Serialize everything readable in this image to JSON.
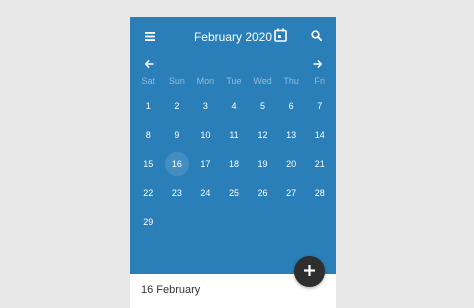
{
  "header": {
    "title": "February 2020",
    "menu_icon": "hamburger-menu-icon",
    "today_icon": "calendar-icon",
    "search_icon": "search-icon"
  },
  "weekdays": [
    "Sat",
    "Sun",
    "Mon",
    "Tue",
    "Wed",
    "Thu",
    "Fri"
  ],
  "days": [
    "1",
    "2",
    "3",
    "4",
    "5",
    "6",
    "7",
    "8",
    "9",
    "10",
    "11",
    "12",
    "13",
    "14",
    "15",
    "16",
    "17",
    "18",
    "19",
    "20",
    "21",
    "22",
    "23",
    "24",
    "25",
    "26",
    "27",
    "28",
    "29"
  ],
  "selected_day": "16",
  "detail": {
    "date": "16 February"
  },
  "fab_icon": "plus-icon",
  "colors": {
    "primary": "#2a7fb8",
    "fab": "#2e2e2e",
    "weekday": "#8fbddc"
  }
}
